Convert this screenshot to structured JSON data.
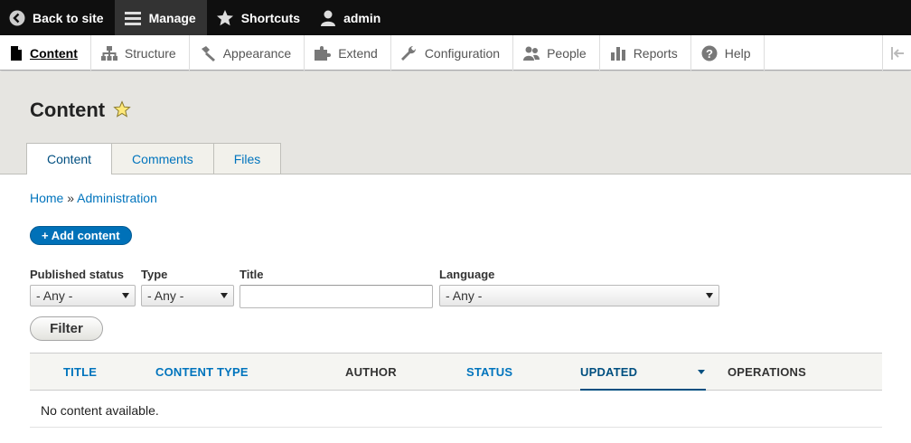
{
  "toolbar": {
    "back": "Back to site",
    "manage": "Manage",
    "shortcuts": "Shortcuts",
    "user": "admin"
  },
  "tray": {
    "items": [
      {
        "label": "Content",
        "icon": "file-icon"
      },
      {
        "label": "Structure",
        "icon": "sitemap-icon"
      },
      {
        "label": "Appearance",
        "icon": "paint-icon"
      },
      {
        "label": "Extend",
        "icon": "puzzle-icon"
      },
      {
        "label": "Configuration",
        "icon": "wrench-icon"
      },
      {
        "label": "People",
        "icon": "people-icon"
      },
      {
        "label": "Reports",
        "icon": "bar-chart-icon"
      },
      {
        "label": "Help",
        "icon": "help-icon"
      }
    ]
  },
  "page": {
    "title": "Content",
    "tabs": [
      "Content",
      "Comments",
      "Files"
    ]
  },
  "breadcrumb": {
    "home": "Home",
    "separator": "»",
    "admin": "Administration"
  },
  "add_content": "+ Add content",
  "filters": {
    "published_status": {
      "label": "Published status",
      "value": "- Any -"
    },
    "type": {
      "label": "Type",
      "value": "- Any -"
    },
    "title": {
      "label": "Title",
      "value": ""
    },
    "language": {
      "label": "Language",
      "value": "- Any -"
    },
    "button": "Filter"
  },
  "table": {
    "headers": [
      "Title",
      "Content type",
      "Author",
      "Status",
      "Updated",
      "Operations"
    ],
    "empty": "No content available."
  },
  "colors": {
    "accent": "#0074bd",
    "toolbar": "#0f0f0f",
    "header_bg": "#e6e5e1"
  }
}
